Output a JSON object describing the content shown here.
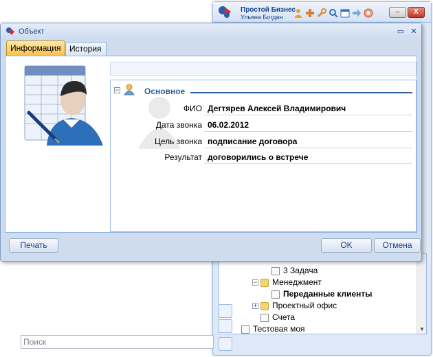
{
  "app": {
    "title": "Простой Бизнес",
    "user": "Ульяна Богдан",
    "toolbar_icons": [
      "person-icon",
      "add-icon",
      "wrench-icon",
      "search-icon",
      "calendar-icon",
      "arrow-right-icon",
      "help-icon"
    ],
    "tree": [
      {
        "label": "3 Задача",
        "bold": false
      },
      {
        "label": "Менеджмент",
        "bold": false
      },
      {
        "label": "Переданные клиенты",
        "bold": true
      },
      {
        "label": "Проектный офис",
        "bold": false
      },
      {
        "label": "Счета",
        "bold": false
      },
      {
        "label": "Тестовая моя",
        "bold": false
      }
    ],
    "search_placeholder": "Поиск"
  },
  "dialog": {
    "title": "Объект",
    "tabs": [
      "Информация",
      "История"
    ],
    "active_tab": "Информация",
    "section_title": "Основное",
    "fields": [
      {
        "label": "ФИО",
        "value": "Дегтярев Алексей Владимирович"
      },
      {
        "label": "Дата звонка",
        "value": "06.02.2012"
      },
      {
        "label": "Цель звонка",
        "value": "подписание договора"
      },
      {
        "label": "Результат",
        "value": "договорились о встрече"
      }
    ],
    "buttons": {
      "print": "Печать",
      "ok": "OK",
      "cancel": "Отмена"
    }
  },
  "colors": {
    "accent": "#15428b",
    "section": "#2e5f97",
    "active_tab": "#f9c24b",
    "close": "#c13b24"
  }
}
